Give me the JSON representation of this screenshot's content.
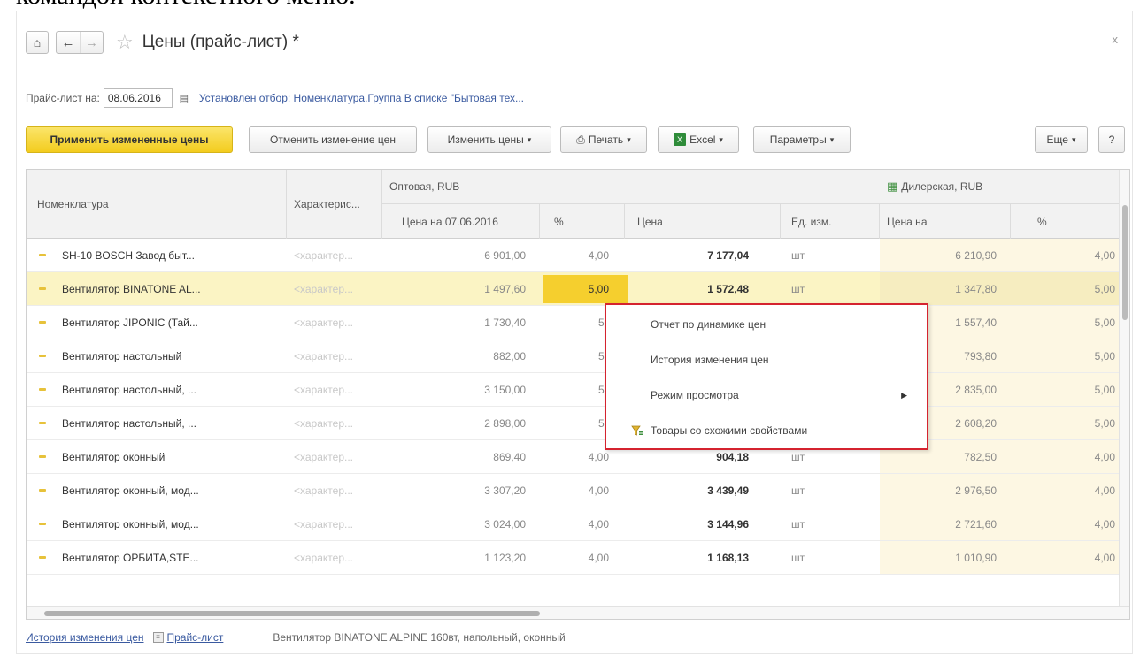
{
  "caption": "командой контекстного меню.",
  "window": {
    "title": "Цены (прайс-лист) *",
    "close_glyph": "x"
  },
  "filter": {
    "date_label": "Прайс-лист на:",
    "date_value": "08.06.2016",
    "filter_link": "Установлен отбор: Номенклатура.Группа В списке \"Бытовая тех..."
  },
  "toolbar": {
    "apply": "Применить измененные цены",
    "cancel": "Отменить изменение цен",
    "change": "Изменить цены",
    "print": "Печать",
    "excel": "Excel",
    "params": "Параметры",
    "more": "Еще",
    "help": "?"
  },
  "grid": {
    "headers": {
      "nomenclature": "Номенклатура",
      "characteristic": "Характерис...",
      "wholesale": "Оптовая, RUB",
      "dealer": "Дилерская, RUB",
      "price_on": "Цена на 07.06.2016",
      "pct": "%",
      "price": "Цена",
      "unit": "Ед. изм.",
      "dealer_price_on": "Цена на",
      "dealer_pct": "%"
    },
    "rows": [
      {
        "name": "SH-10 BOSCH Завод быт...",
        "char": "<характер...",
        "opt": "6 901,00",
        "pct": "4,00",
        "price": "7 177,04",
        "unit": "шт",
        "dprice": "6 210,90",
        "dpct": "4,00"
      },
      {
        "name": "Вентилятор BINATONE AL...",
        "char": "<характер...",
        "opt": "1 497,60",
        "pct": "5,00",
        "price": "1 572,48",
        "unit": "шт",
        "dprice": "1 347,80",
        "dpct": "5,00"
      },
      {
        "name": "Вентилятор JIPONIC (Тай...",
        "char": "<характер...",
        "opt": "1 730,40",
        "pct": "5",
        "price": "",
        "unit": "",
        "dprice": "1 557,40",
        "dpct": "5,00"
      },
      {
        "name": "Вентилятор настольный",
        "char": "<характер...",
        "opt": "882,00",
        "pct": "5",
        "price": "",
        "unit": "",
        "dprice": "793,80",
        "dpct": "5,00"
      },
      {
        "name": "Вентилятор настольный, ...",
        "char": "<характер...",
        "opt": "3 150,00",
        "pct": "5",
        "price": "",
        "unit": "",
        "dprice": "2 835,00",
        "dpct": "5,00"
      },
      {
        "name": "Вентилятор настольный, ...",
        "char": "<характер...",
        "opt": "2 898,00",
        "pct": "5",
        "price": "",
        "unit": "",
        "dprice": "2 608,20",
        "dpct": "5,00"
      },
      {
        "name": "Вентилятор оконный",
        "char": "<характер...",
        "opt": "869,40",
        "pct": "4,00",
        "price": "904,18",
        "unit": "шт",
        "dprice": "782,50",
        "dpct": "4,00"
      },
      {
        "name": "Вентилятор оконный, мод...",
        "char": "<характер...",
        "opt": "3 307,20",
        "pct": "4,00",
        "price": "3 439,49",
        "unit": "шт",
        "dprice": "2 976,50",
        "dpct": "4,00"
      },
      {
        "name": "Вентилятор оконный, мод...",
        "char": "<характер...",
        "opt": "3 024,00",
        "pct": "4,00",
        "price": "3 144,96",
        "unit": "шт",
        "dprice": "2 721,60",
        "dpct": "4,00"
      },
      {
        "name": "Вентилятор ОРБИТА,STE...",
        "char": "<характер...",
        "opt": "1 123,20",
        "pct": "4,00",
        "price": "1 168,13",
        "unit": "шт",
        "dprice": "1 010,90",
        "dpct": "4,00"
      }
    ]
  },
  "context_menu": {
    "items": [
      "Отчет по динамике цен",
      "История изменения цен",
      "Режим просмотра",
      "Товары со схожими свойствами"
    ]
  },
  "footer": {
    "history_link": "История изменения цен",
    "pricelist_link": "Прайс-лист",
    "info": "Вентилятор BINATONE ALPINE 160вт, напольный, оконный"
  }
}
